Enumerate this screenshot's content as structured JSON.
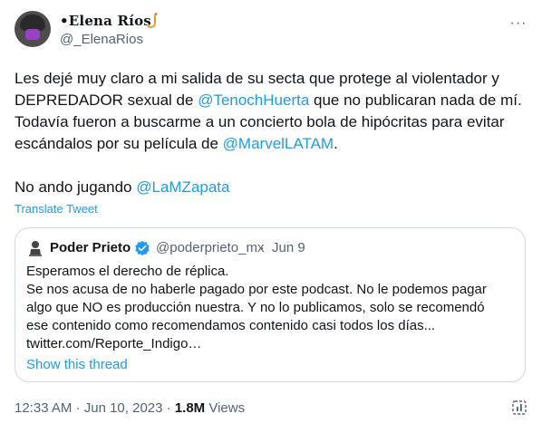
{
  "author": {
    "name": "•Elena Ríos",
    "handle": "@_ElenaRios",
    "avatar_icon": "profile-avatar",
    "badge_icon": "saxophone-icon",
    "more_label": "···"
  },
  "tweet": {
    "line1": "Les dejé muy claro a mi salida de su secta que protege al violentador y",
    "line2_pre": "DEPREDADOR sexual de ",
    "line2_link": "@TenochHuerta",
    "line2_post": " que no publicaran nada de mí.",
    "line3": "Todavía fueron a buscarme a un concierto bola de hipócritas para evitar",
    "line4_pre": "escándalos por su película de ",
    "line4_link": "@MarvelLATAM",
    "line4_post": ".",
    "line5_pre": "No ando jugando ",
    "line5_link": "@LaMZapata",
    "translate_label": "Translate Tweet"
  },
  "quote": {
    "name": "Poder Prieto",
    "handle": "@poderprieto_mx",
    "sep": "·",
    "date": "Jun 9",
    "lines": [
      "Esperamos el derecho de réplica.",
      "Se nos acusa de no haberle pagado por este podcast. No le podemos pagar",
      "algo que NO es producción nuestra. Y no lo publicamos, solo se recomendó",
      "ese contenido como recomendamos contenido casi todos los días...",
      "twitter.com/Reporte_Indigo…"
    ],
    "show_thread": "Show this thread"
  },
  "meta": {
    "time": "12:33 AM",
    "sep1": " · ",
    "date": "Jun 10, 2023",
    "sep2": " · ",
    "views_count": "1.8M",
    "views_label": " Views"
  },
  "colors": {
    "link": "#1d9bf0",
    "secondary": "#536471",
    "text": "#0f1419",
    "border": "#cfd9de",
    "verified": "#1d9bf0"
  }
}
